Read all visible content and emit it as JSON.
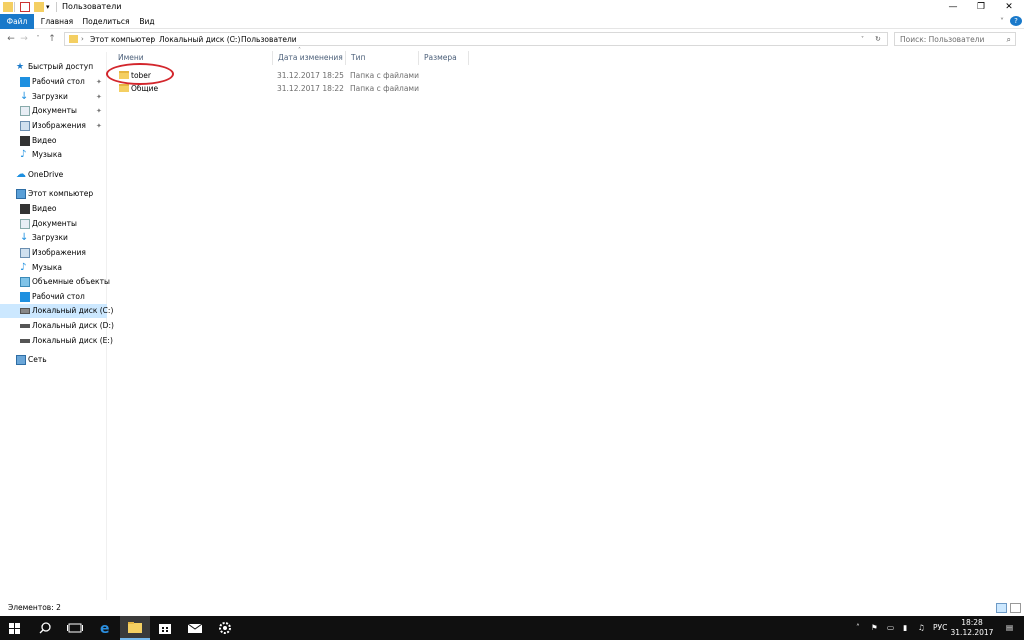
{
  "window": {
    "title": "Пользователи",
    "controls": {
      "minimize": "—",
      "maximize": "❐",
      "close": "✕"
    }
  },
  "ribbon": {
    "tabs": [
      "Файл",
      "Главная",
      "Поделиться",
      "Вид"
    ]
  },
  "address": {
    "crumbs": [
      "Этот компьютер",
      "Локальный диск (C:)",
      "Пользователи"
    ],
    "search_placeholder": "Поиск: Пользователи"
  },
  "sidebar": {
    "quick_access": "Быстрый доступ",
    "quick_items": [
      "Рабочий стол",
      "Загрузки",
      "Документы",
      "Изображения",
      "Видео",
      "Музыка"
    ],
    "onedrive": "OneDrive",
    "this_pc": "Этот компьютер",
    "pc_items": [
      "Видео",
      "Документы",
      "Загрузки",
      "Изображения",
      "Музыка",
      "Объемные объекты",
      "Рабочий стол",
      "Локальный диск (C:)",
      "Локальный диск (D:)",
      "Локальный диск (E:)"
    ],
    "network": "Сеть",
    "selected": "Локальный диск (C:)"
  },
  "columns": [
    "Имени",
    "Дата изменения",
    "Тип",
    "Размера"
  ],
  "files": [
    {
      "name": "tober",
      "date": "31.12.2017 18:25",
      "type": "Папка с файлами"
    },
    {
      "name": "Общие",
      "date": "31.12.2017 18:22",
      "type": "Папка с файлами"
    }
  ],
  "status": {
    "count": "Элементов: 2"
  },
  "taskbar": {
    "lang": "РУС",
    "time": "18:28",
    "date": "31.12.2017"
  },
  "colors": {
    "file_tab": "#1979ca",
    "selection": "#cce8ff",
    "highlight_ellipse": "#d3262c",
    "taskbar": "#101010"
  }
}
